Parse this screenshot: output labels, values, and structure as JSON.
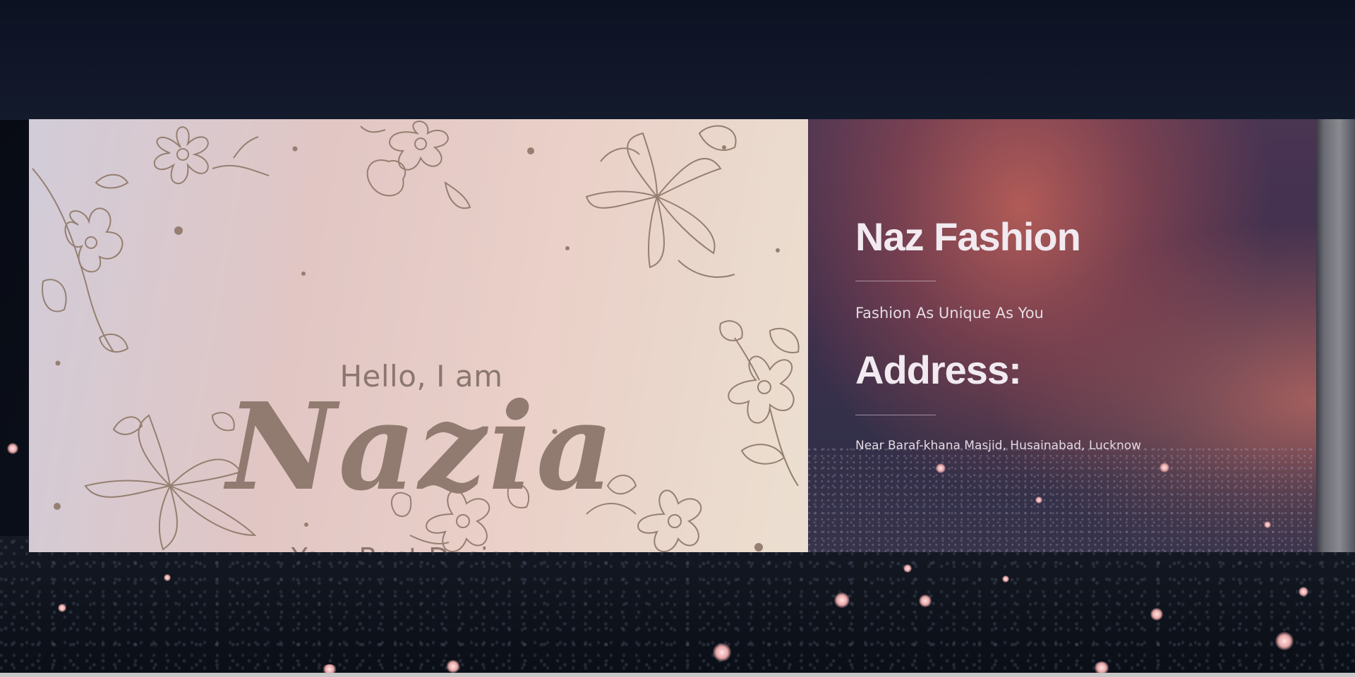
{
  "banner": {
    "greeting": "Hello, I am",
    "name": "Nazia",
    "tagline": "Your Best Designer"
  },
  "info": {
    "brand_title": "Naz Fashion",
    "brand_tagline": "Fashion As Unique As You",
    "address_heading": "Address:",
    "address": "Near Baraf-khana Masjid, Husainabad, Lucknow"
  },
  "colors": {
    "banner_text": "#8b776d",
    "info_text": "#f1eaf0",
    "info_panel": "#3d2e4c",
    "background": "#0b0f1c"
  },
  "decorations": {
    "flower_icon": "flower-icon",
    "sparkle_icon": "sparkle-icon"
  }
}
